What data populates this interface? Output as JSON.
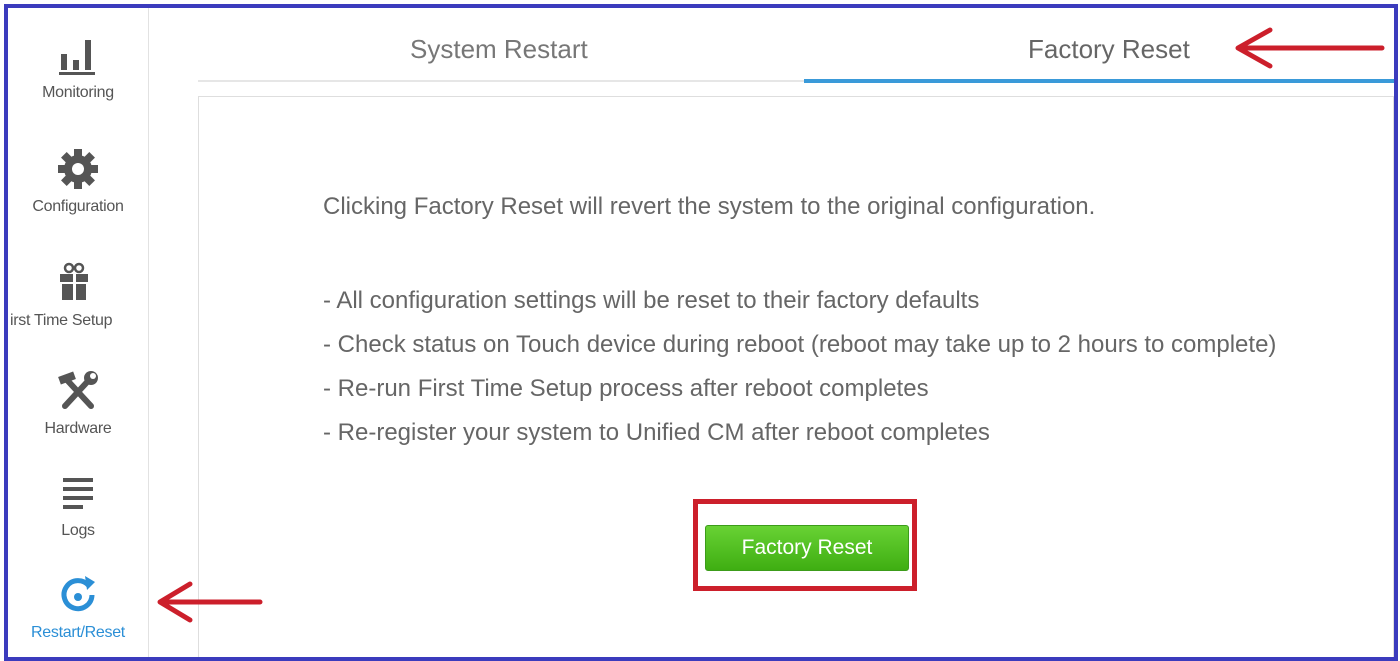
{
  "sidebar": {
    "items": [
      {
        "label": "Monitoring",
        "icon": "bar-chart-icon",
        "active": false
      },
      {
        "label": "Configuration",
        "icon": "gear-icon",
        "active": false
      },
      {
        "label": "irst Time Setup",
        "icon": "gift-icon",
        "active": false
      },
      {
        "label": "Hardware",
        "icon": "tools-icon",
        "active": false
      },
      {
        "label": "Logs",
        "icon": "list-icon",
        "active": false
      },
      {
        "label": "Restart/Reset",
        "icon": "restart-icon",
        "active": true
      }
    ]
  },
  "tabs": [
    {
      "label": "System Restart",
      "active": false
    },
    {
      "label": "Factory Reset",
      "active": true
    }
  ],
  "content": {
    "intro": "Clicking Factory Reset will revert the system to the original configuration.",
    "bullets": [
      "- All configuration settings will be reset to their factory defaults",
      "- Check status on Touch device during reboot (reboot may take up to 2 hours to complete)",
      "- Re-run First Time Setup process after reboot completes",
      "- Re-register your system to Unified CM after reboot completes"
    ],
    "button_label": "Factory Reset"
  },
  "colors": {
    "frame": "#3b3bbd",
    "accent": "#2b8fd6",
    "button": "#4cbf1e",
    "annotation": "#cc1f2b"
  }
}
